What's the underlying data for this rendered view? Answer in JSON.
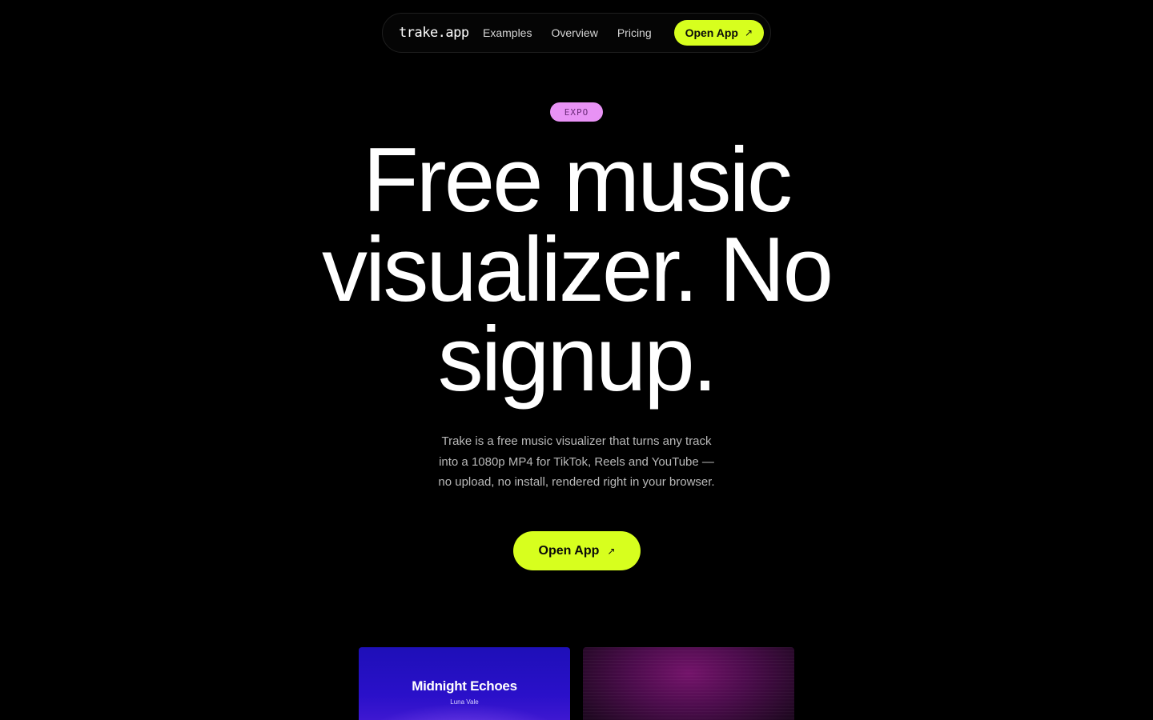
{
  "nav": {
    "logo": "trake.app",
    "links": [
      "Examples",
      "Overview",
      "Pricing"
    ],
    "cta_label": "Open App",
    "cta_icon": "arrow-up-right-icon"
  },
  "hero": {
    "badge": "EXPO",
    "headline": [
      "Free music",
      "visualizer. No",
      "signup."
    ],
    "subtitle": [
      "Trake is a free music visualizer that turns any track",
      "into a 1080p MP4 for TikTok, Reels and YouTube —",
      "no upload, no install, rendered right in your browser."
    ],
    "cta_label": "Open App",
    "cta_icon": "arrow-up-right-icon"
  },
  "examples": [
    {
      "title": "Midnight Echoes",
      "artist": "Luna Vale"
    },
    {
      "title": "",
      "artist": ""
    }
  ],
  "colors": {
    "background": "#000000",
    "accent": "#d7ff1e",
    "badge": "#e892f5"
  }
}
